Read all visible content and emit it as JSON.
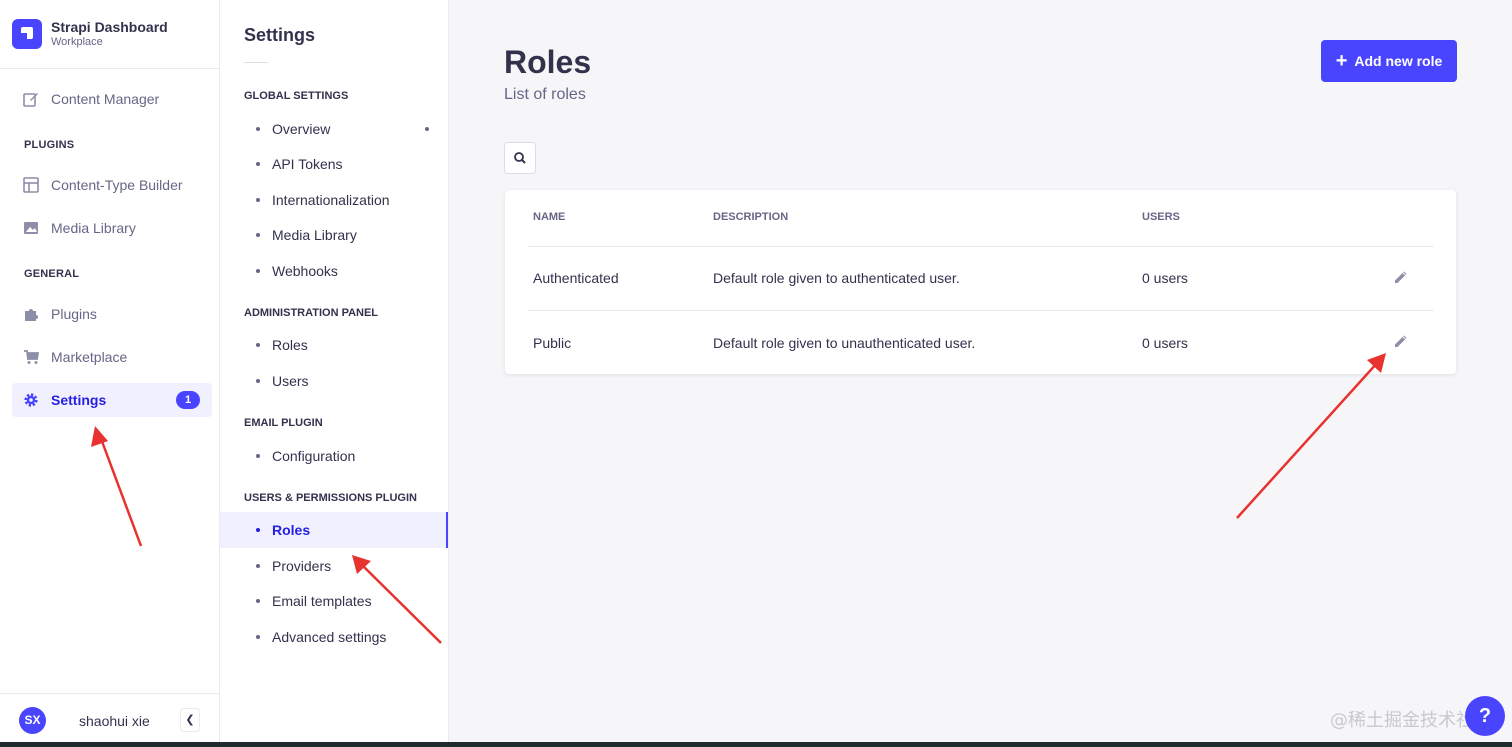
{
  "brand": {
    "title": "Strapi Dashboard",
    "subtitle": "Workplace"
  },
  "mainnav": {
    "content_manager": "Content Manager",
    "plugins_section": "PLUGINS",
    "content_type_builder": "Content-Type Builder",
    "media_library": "Media Library",
    "general_section": "GENERAL",
    "plugins": "Plugins",
    "marketplace": "Marketplace",
    "settings": "Settings",
    "settings_badge": "1"
  },
  "user": {
    "initials": "SX",
    "name": "shaohui xie",
    "collapse_icon": "chevron-left-icon"
  },
  "subnav": {
    "title": "Settings",
    "global_section": "GLOBAL SETTINGS",
    "overview": "Overview",
    "api_tokens": "API Tokens",
    "internationalization": "Internationalization",
    "media_library": "Media Library",
    "webhooks": "Webhooks",
    "admin_section": "ADMINISTRATION PANEL",
    "admin_roles": "Roles",
    "admin_users": "Users",
    "email_section": "EMAIL PLUGIN",
    "configuration": "Configuration",
    "up_section": "USERS & PERMISSIONS PLUGIN",
    "up_roles": "Roles",
    "providers": "Providers",
    "email_templates": "Email templates",
    "advanced_settings": "Advanced settings"
  },
  "header": {
    "title": "Roles",
    "subtitle": "List of roles",
    "add_button": "Add new role"
  },
  "table": {
    "columns": [
      "NAME",
      "DESCRIPTION",
      "USERS"
    ],
    "rows": [
      {
        "name": "Authenticated",
        "description": "Default role given to authenticated user.",
        "users": "0 users"
      },
      {
        "name": "Public",
        "description": "Default role given to unauthenticated user.",
        "users": "0 users"
      }
    ]
  },
  "help": "?",
  "watermark": "@稀土掘金技术社区",
  "colors": {
    "primary": "#4945ff",
    "active_text": "#271fe0",
    "annotation": "#e8322f"
  }
}
